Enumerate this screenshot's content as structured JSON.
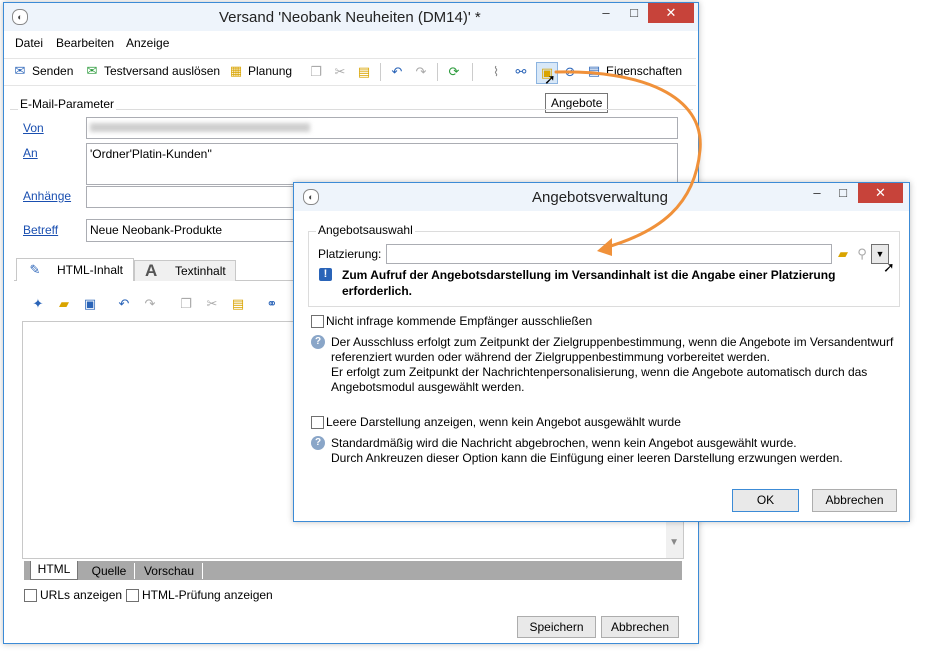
{
  "main_window": {
    "title": "Versand 'Neobank Neuheiten (DM14)' *",
    "menu": [
      "Datei",
      "Bearbeiten",
      "Anzeige"
    ],
    "toolbar": {
      "send_label": "Senden",
      "test_label": "Testversand auslösen",
      "schedule_label": "Planung",
      "properties_label": "Eigenschaften",
      "tooltip": "Angebote"
    },
    "email_params": {
      "group_label": "E-Mail-Parameter",
      "from_label": "Von",
      "to_label": "An",
      "to_value": "'Ordner'Platin-Kunden''",
      "attachments_label": "Anhänge",
      "subject_label": "Betreff",
      "subject_value": "Neue Neobank-Produkte"
    },
    "content_tabs": [
      "HTML-Inhalt",
      "Textinhalt"
    ],
    "bottom_tabs": [
      "HTML",
      "Quelle",
      "Vorschau"
    ],
    "checkboxes": [
      "URLs anzeigen",
      "HTML-Prüfung anzeigen"
    ],
    "buttons": {
      "save": "Speichern",
      "cancel": "Abbrechen"
    }
  },
  "dialog": {
    "title": "Angebotsverwaltung",
    "group_label": "Angebotsauswahl",
    "placement_label": "Platzierung:",
    "placement_value": "",
    "warning_line1": "Zum Aufruf der Angebotsdarstellung im Versandinhalt ist die Angabe einer Platzierung",
    "warning_line2": "erforderlich.",
    "option1_label": "Nicht infrage kommende Empfänger ausschließen",
    "option1_info": [
      "Der Ausschluss erfolgt zum Zeitpunkt der Zielgruppenbestimmung, wenn die Angebote im Versandentwurf",
      "referenziert wurden oder während der Zielgruppenbestimmung vorbereitet werden.",
      "Er erfolgt zum Zeitpunkt der Nachrichtenpersonalisierung, wenn die Angebote automatisch durch das",
      "Angebotsmodul ausgewählt werden."
    ],
    "option2_label": "Leere Darstellung anzeigen, wenn kein Angebot ausgewählt wurde",
    "option2_info": [
      "Standardmäßig wird die Nachricht abgebrochen, wenn kein Angebot ausgewählt wurde.",
      "Durch Ankreuzen dieser Option kann die Einfügung einer leeren Darstellung erzwungen werden."
    ],
    "ok_label": "OK",
    "cancel_label": "Abbrechen"
  },
  "colors": {
    "accent": "#3c8bd6",
    "close_button": "#c7433a",
    "callout_arrow": "#f0913a",
    "link": "#1a4fb0"
  }
}
